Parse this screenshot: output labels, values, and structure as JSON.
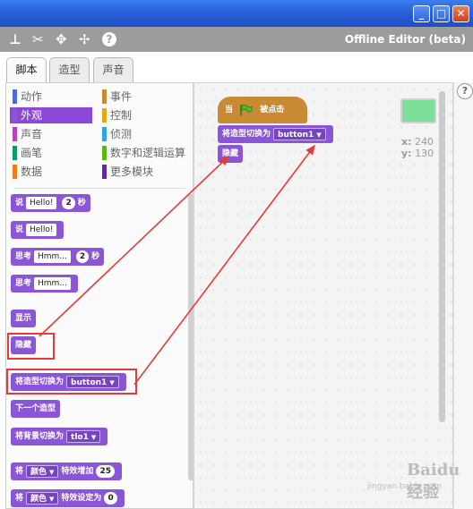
{
  "window": {
    "minimize": "_",
    "maximize": "□",
    "close": "✕"
  },
  "menubar": {
    "title": "Offline Editor (beta)",
    "icons": [
      "duplicate-icon",
      "cut-icon",
      "grow-icon",
      "shrink-icon",
      "help-icon"
    ],
    "help_glyph": "?"
  },
  "tabs": [
    {
      "label": "脚本",
      "active": true
    },
    {
      "label": "造型",
      "active": false
    },
    {
      "label": "声音",
      "active": false
    }
  ],
  "categories": [
    {
      "label": "动作",
      "color": "#4a6cd4"
    },
    {
      "label": "事件",
      "color": "#c88a34"
    },
    {
      "label": "外观",
      "color": "#8a55d7",
      "selected": true
    },
    {
      "label": "控制",
      "color": "#e1a91a"
    },
    {
      "label": "声音",
      "color": "#bb42c3"
    },
    {
      "label": "侦测",
      "color": "#2ca5e2"
    },
    {
      "label": "画笔",
      "color": "#0e9a6c"
    },
    {
      "label": "数字和逻辑运算",
      "color": "#5cb712"
    },
    {
      "label": "数据",
      "color": "#ee7d16"
    },
    {
      "label": "更多模块",
      "color": "#632d99"
    }
  ],
  "palette_blocks": {
    "say_for": {
      "word": "说",
      "text": "Hello!",
      "secs": "2",
      "unit": "秒"
    },
    "say": {
      "word": "说",
      "text": "Hello!"
    },
    "think_for": {
      "word": "思考",
      "text": "Hmm...",
      "secs": "2",
      "unit": "秒"
    },
    "think": {
      "word": "思考",
      "text": "Hmm..."
    },
    "show": "显示",
    "hide": "隐藏",
    "switch_costume": {
      "text": "将造型切换为",
      "value": "button1"
    },
    "next_costume": "下一个造型",
    "switch_backdrop": {
      "text": "将背景切换为",
      "value": "tlo1"
    },
    "change_effect": {
      "word": "将",
      "effect": "颜色",
      "text": "特效增加",
      "value": "25"
    },
    "set_effect": {
      "word": "将",
      "effect": "颜色",
      "text": "特效设定为",
      "value": "0"
    }
  },
  "script": {
    "hat": {
      "prefix": "当",
      "suffix": "被点击"
    },
    "switch_costume": {
      "text": "将造型切换为",
      "value": "button1"
    },
    "hide": "隐藏"
  },
  "sprite_info": {
    "x_label": "x:",
    "x_value": "240",
    "y_label": "y:",
    "y_value": "130"
  },
  "help_tab": "?",
  "watermark": {
    "main": "Baidu经验",
    "sub": "jingyan.baidu.com"
  }
}
